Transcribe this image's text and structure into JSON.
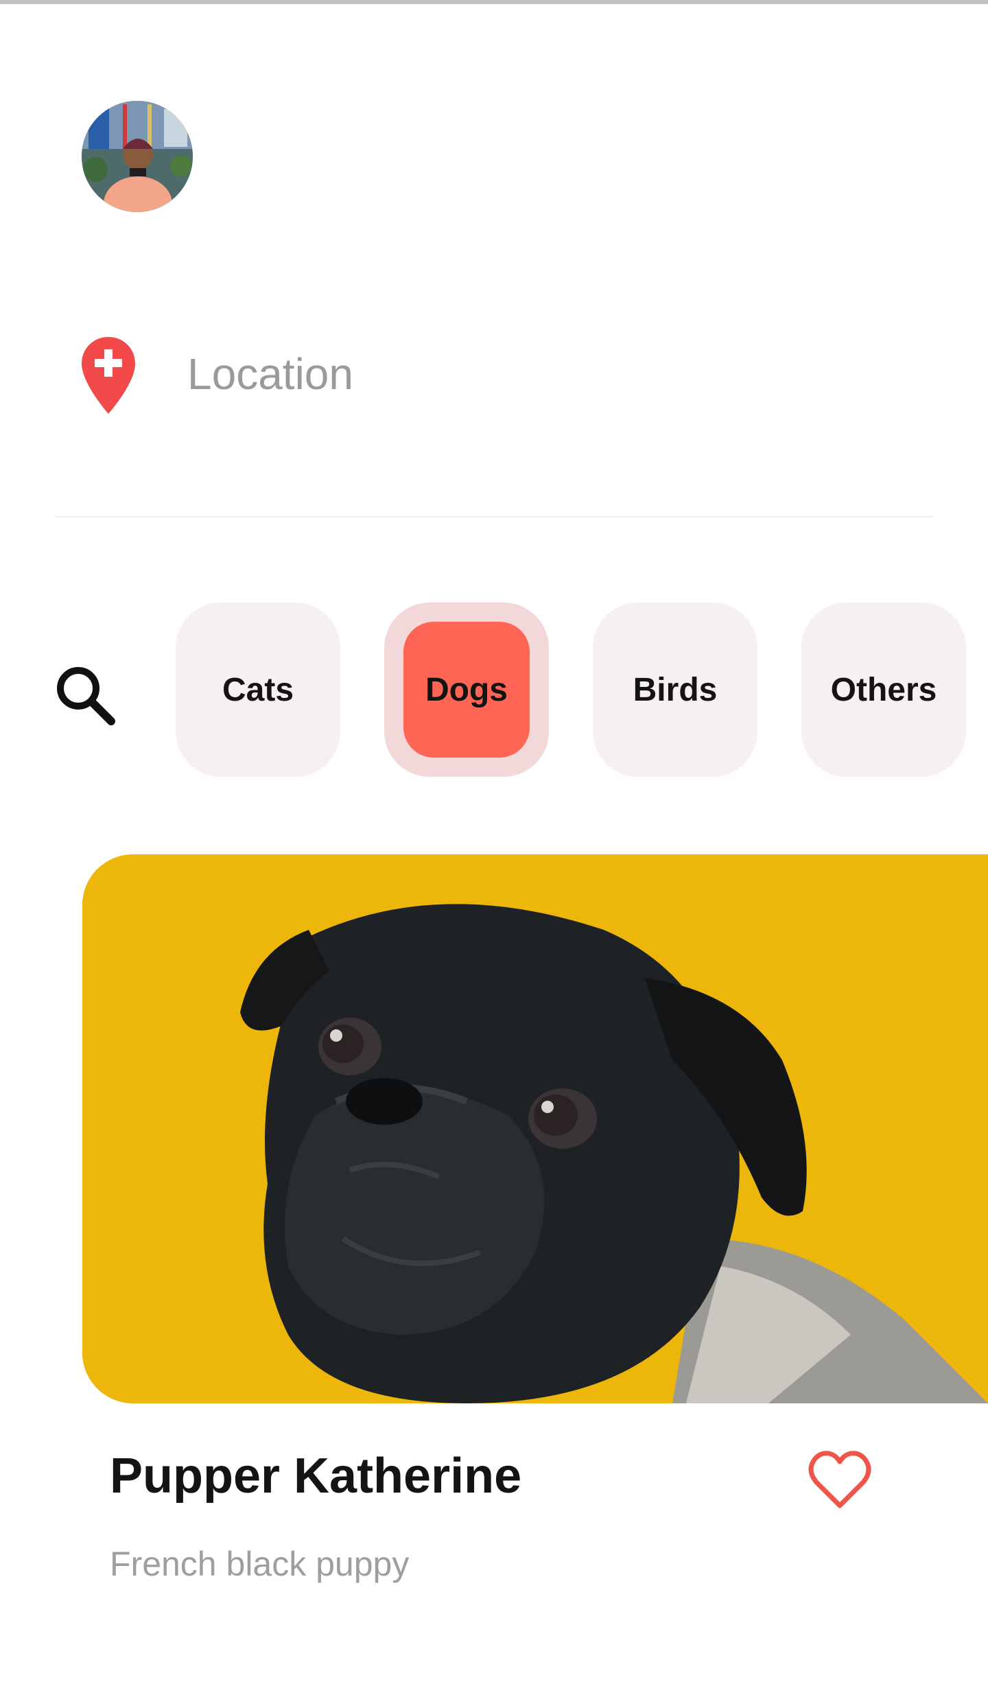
{
  "colors": {
    "accent": "#FE6555",
    "accent_soft": "#F2D8D8",
    "chip_bg": "#F7F0F2",
    "card_bg": "#ECB60A",
    "divider": "#EDEDED"
  },
  "header": {
    "avatar_icon": "user-avatar"
  },
  "location": {
    "icon": "map-pin-plus-icon",
    "placeholder": "Location"
  },
  "filters": {
    "search_icon": "search-icon",
    "categories": [
      {
        "label": "Cats",
        "selected": false
      },
      {
        "label": "Dogs",
        "selected": true
      },
      {
        "label": "Birds",
        "selected": false
      },
      {
        "label": "Others",
        "selected": false
      }
    ]
  },
  "pet_card": {
    "image": "black-pug-on-yellow-photo",
    "name": "Pupper Katherine",
    "description": "French black puppy",
    "favorite_icon": "heart-outline-icon",
    "favorited": false
  }
}
